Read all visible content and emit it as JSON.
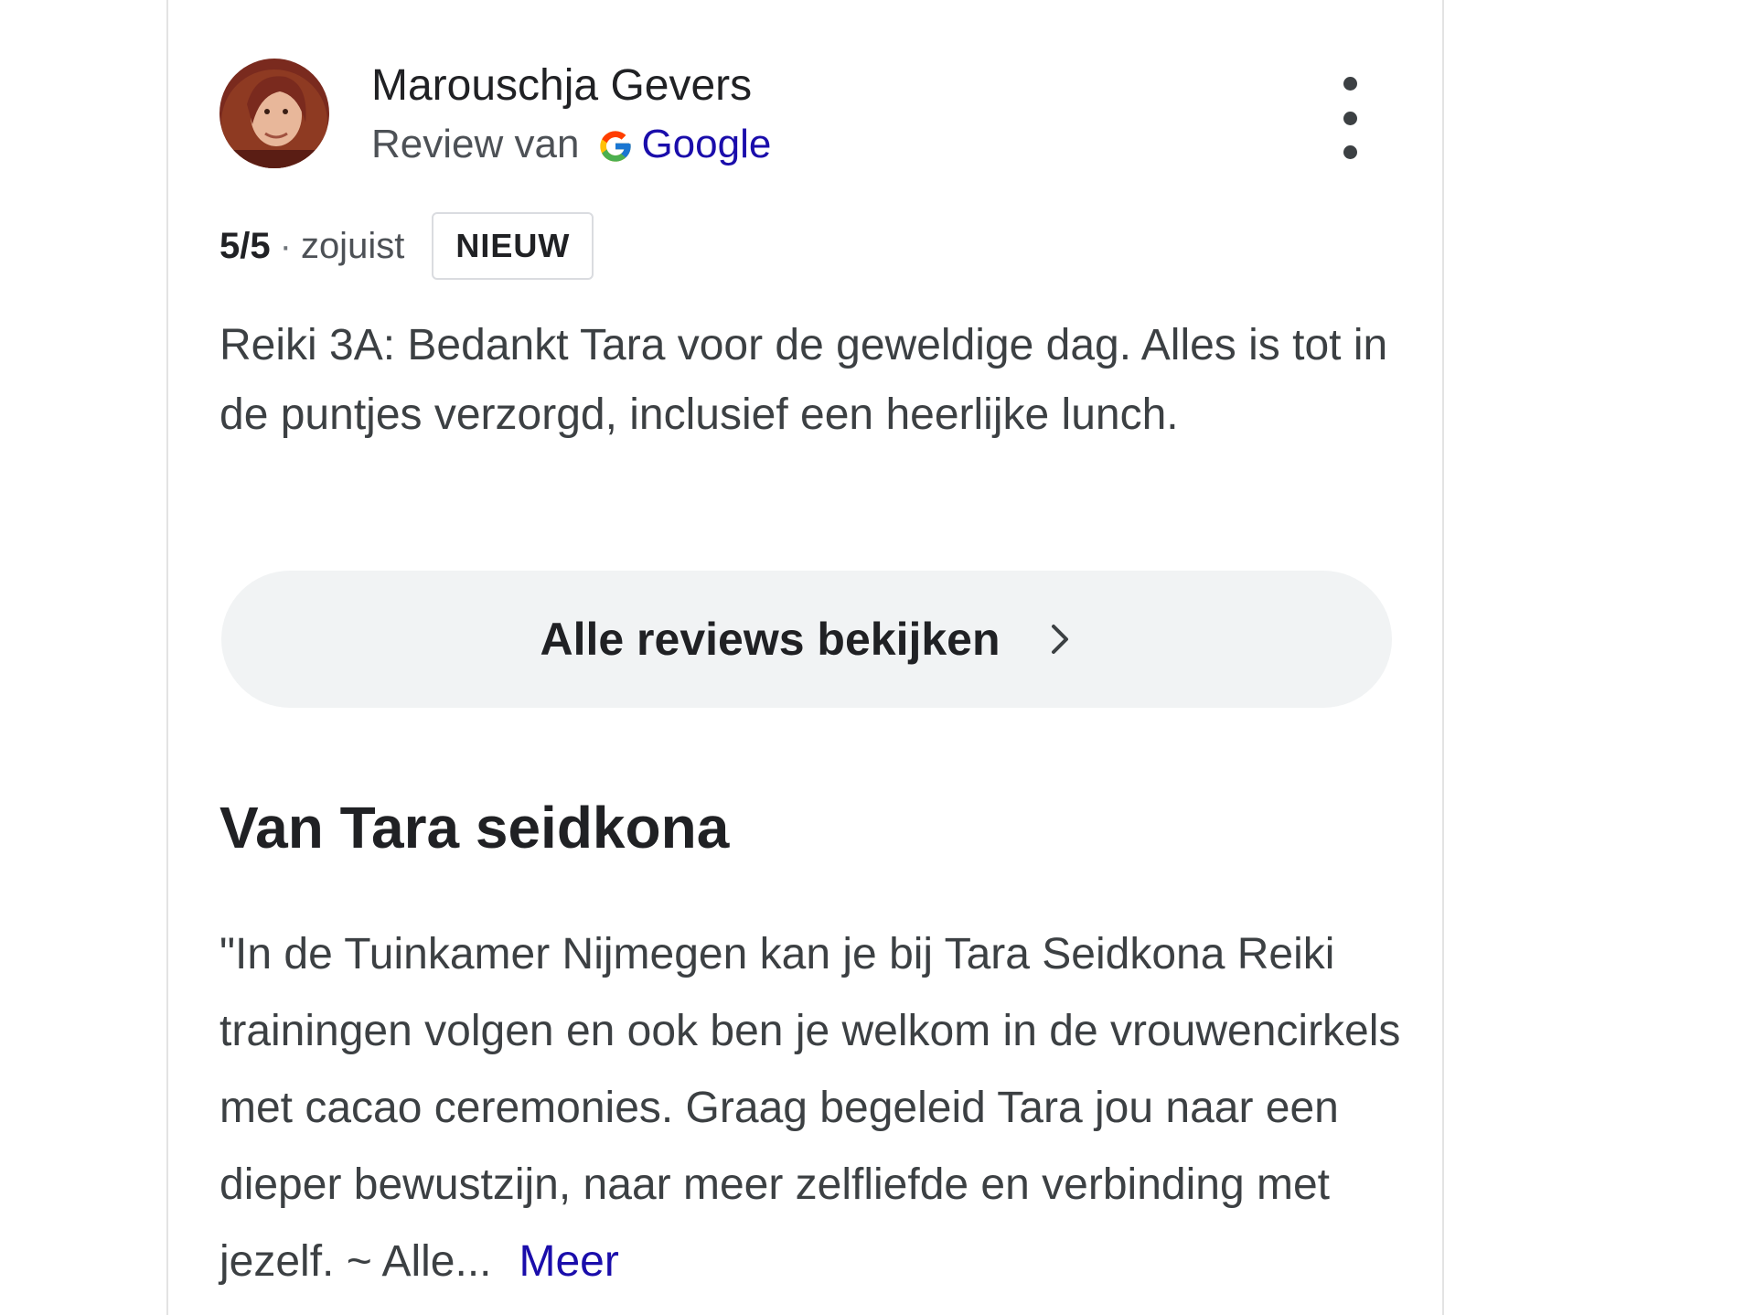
{
  "review": {
    "reviewer_name": "Marouschja Gevers",
    "source_prefix": "Review van",
    "source_name": "Google",
    "rating": "5/5",
    "separator": "·",
    "time": "zojuist",
    "badge": "NIEUW",
    "text": "Reiki 3A: Bedankt Tara voor de geweldige dag. Alles is tot in de puntjes verzorgd, inclusief een heerlijke lunch."
  },
  "all_reviews_button": {
    "label": "Alle reviews bekijken"
  },
  "from_business": {
    "heading": "Van Tara seidkona",
    "description": "\"In de Tuinkamer Nijmegen kan je bij Tara Seidkona Reiki trainingen volgen en ook ben je welkom in de vrouwencirkels met cacao ceremonies. Graag begeleid Tara jou naar een dieper bewustzijn, naar meer zelfliefde en verbinding met jezelf. ~ Alle...",
    "more_label": "Meer"
  },
  "colors": {
    "link": "#1a0dab",
    "button_bg": "#f1f3f4",
    "text_primary": "#202124",
    "text_secondary": "#4d5156"
  },
  "icons": {
    "avatar": "avatar",
    "google": "google-g-icon",
    "menu": "more-vert-icon",
    "chevron": "chevron-right-icon"
  }
}
